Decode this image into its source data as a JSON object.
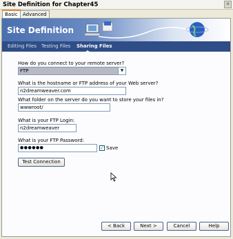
{
  "window": {
    "title": "Site Definition for Chapter45",
    "close_glyph": "✕"
  },
  "tabs": [
    {
      "label": "Basic",
      "active": true
    },
    {
      "label": "Advanced",
      "active": false
    }
  ],
  "banner": {
    "title": "Site Definition"
  },
  "steps": [
    {
      "label": "Editing Files",
      "active": false
    },
    {
      "label": "Testing Files",
      "active": false
    },
    {
      "label": "Sharing Files",
      "active": true
    }
  ],
  "form": {
    "connect_label": "How do you connect to your remote server?",
    "connect_value": "FTP",
    "host_label": "What is the hostname or FTP address of your Web server?",
    "host_value": "n2dreamweaver.com",
    "folder_label": "What folder on the server do you want to store your files in?",
    "folder_value": "wwwroot/",
    "login_label": "What is your FTP Login:",
    "login_value": "n2dreamweaver",
    "password_label": "What is your FTP Password:",
    "password_value": "●●●●●●",
    "save_label": "Save",
    "save_checked": true,
    "test_button": "Test Connection"
  },
  "buttons": {
    "back": "< Back",
    "next": "Next >",
    "cancel": "Cancel",
    "help": "Help"
  },
  "colors": {
    "banner_start": "#4a6fae",
    "navbar": "#2f4d86",
    "tab_highlight": "#e68b2c"
  }
}
